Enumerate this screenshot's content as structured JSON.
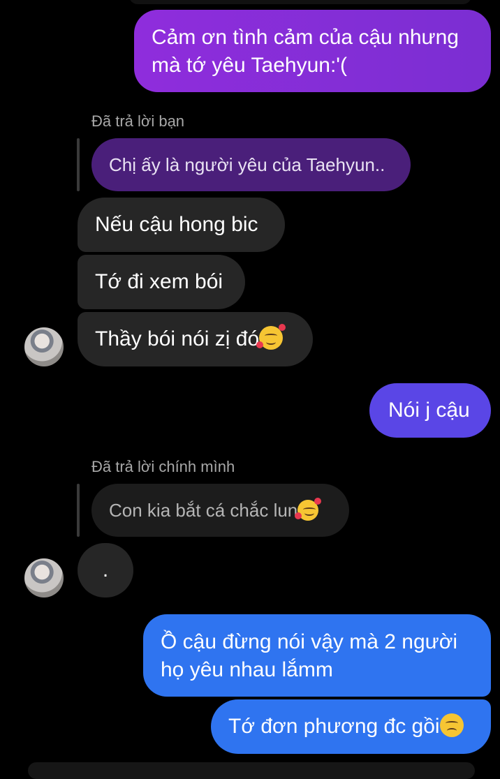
{
  "colors": {
    "background": "#000000",
    "incoming_bubble": "#262626",
    "outgoing_purple": "#8a2bd6",
    "outgoing_violet": "#5a46e6",
    "outgoing_blue": "#2f74f0",
    "quoted_purple": "#4a1f7a"
  },
  "messages": {
    "m1": "Cảm ơn tình cảm của cậu nhưng mà tớ yêu Taehyun:'(",
    "reply1_label": "Đã trả lời bạn",
    "reply1_quote": "Chị ấy là người yêu của Taehyun..",
    "m2": "Nếu cậu hong bic",
    "m3": "Tớ đi xem bói",
    "m4": "Thầy bói nói zị đó",
    "m5": "Nói j cậu",
    "reply2_label": "Đã trả lời chính mình",
    "reply2_quote": "Con kia bắt cá chắc lun",
    "m6": ".",
    "m7": "Ồ cậu đừng nói vậy mà 2 người họ yêu nhau lắmm",
    "m8": "Tớ đơn phương đc gồi"
  },
  "icons": {
    "emoji_love": "smiling-face-with-hearts-icon",
    "emoji_pensive": "pensive-face-icon",
    "avatar": "contact-avatar"
  }
}
